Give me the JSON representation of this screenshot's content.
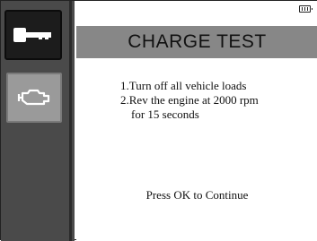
{
  "sidebar": {
    "items": [
      {
        "icon": "key-icon",
        "selected": true
      },
      {
        "icon": "engine-icon",
        "selected": false
      }
    ]
  },
  "status": {
    "battery_icon": "battery-icon"
  },
  "header": {
    "title": "CHARGE TEST"
  },
  "instructions": {
    "line1": "1.Turn off all vehicle loads",
    "line2": "2.Rev the engine at 2000 rpm",
    "line3": "for 15 seconds"
  },
  "prompt": "Press OK to Continue",
  "colors": {
    "sidebar_bg": "#4a4a4a",
    "selected_btn_bg": "#1c1c1c",
    "unselected_btn_bg": "#9a9a9a",
    "title_bar_bg": "#878787"
  }
}
